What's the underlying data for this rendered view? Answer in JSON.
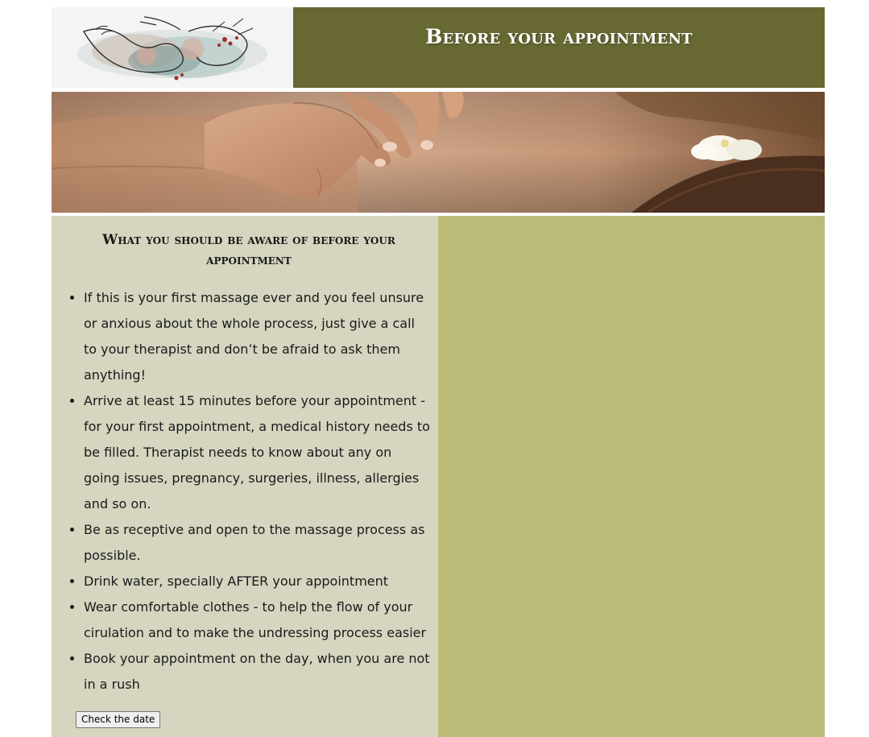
{
  "header": {
    "title": "Before your appointment",
    "logo_icon": "massage-hands-watercolor-logo"
  },
  "hero": {
    "image": "massage-back-photo"
  },
  "content": {
    "heading": "What you should be aware of before your appointment",
    "tips": [
      "If this is your first massage ever and you feel unsure or anxious about the whole process, just give a call to your therapist and don’t be afraid to ask them anything!",
      "Arrive at least 15 minutes before your appointment - for your first appointment, a medical history needs to be filled. Therapist needs to know about any on going issues, pregnancy, surgeries, illness, allergies and so on.",
      "Be as receptive and open to the massage process as possible.",
      "Drink water, specially AFTER your appointment",
      "Wear comfortable clothes - to help the flow of your cirulation and to make the undressing process easier",
      "Book your appointment on the day, when you are not in a rush"
    ],
    "button_label": "Check the date"
  },
  "colors": {
    "header_bg": "#676832",
    "left_panel_bg": "#d5d5c0",
    "right_panel_bg": "#bbbb78",
    "logo_bg": "#f4f4f4"
  }
}
